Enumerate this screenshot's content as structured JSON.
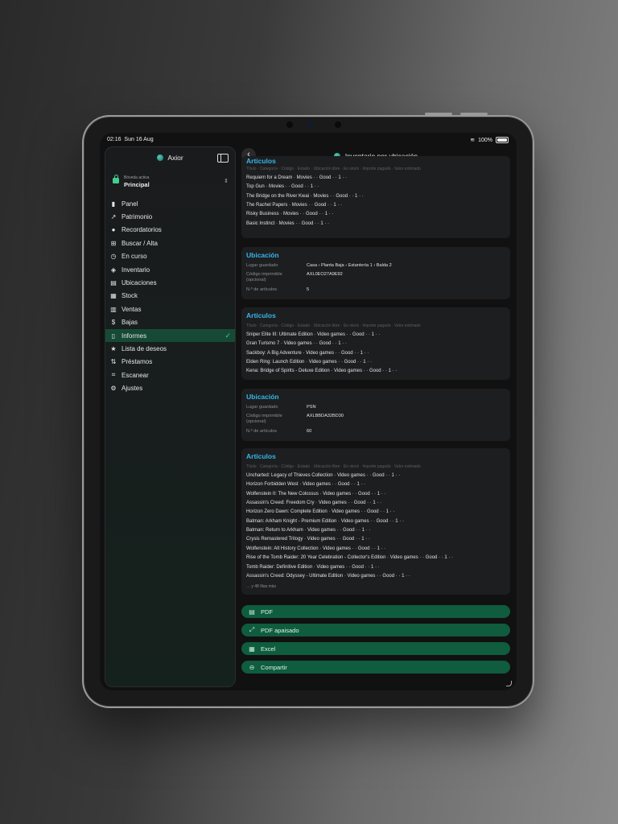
{
  "status": {
    "time": "02:16",
    "date": "Sun 16 Aug",
    "battery": "100%"
  },
  "sidebar": {
    "app_title": "Axior",
    "vault_label": "Bóveda activa",
    "vault_name": "Principal",
    "items": [
      {
        "label": "Panel",
        "icon": "bar-chart-icon",
        "glyph": "▮"
      },
      {
        "label": "Patrimonio",
        "icon": "trend-icon",
        "glyph": "↗"
      },
      {
        "label": "Recordatorios",
        "icon": "bell-icon",
        "glyph": "●"
      },
      {
        "label": "Buscar / Alta",
        "icon": "grid-icon",
        "glyph": "⊞"
      },
      {
        "label": "En curso",
        "icon": "clock-icon",
        "glyph": "◷"
      },
      {
        "label": "Inventario",
        "icon": "box-icon",
        "glyph": "◈"
      },
      {
        "label": "Ubicaciones",
        "icon": "map-icon",
        "glyph": "▤"
      },
      {
        "label": "Stock",
        "icon": "stack-icon",
        "glyph": "▦"
      },
      {
        "label": "Ventas",
        "icon": "barcode-icon",
        "glyph": "▥"
      },
      {
        "label": "Bajas",
        "icon": "dollar-icon",
        "glyph": "$"
      },
      {
        "label": "Informes",
        "icon": "document-icon",
        "glyph": "▯"
      },
      {
        "label": "Lista de deseos",
        "icon": "star-icon",
        "glyph": "★"
      },
      {
        "label": "Préstamos",
        "icon": "swap-icon",
        "glyph": "⇅"
      },
      {
        "label": "Escanear",
        "icon": "scan-icon",
        "glyph": "⌗"
      },
      {
        "label": "Ajustes",
        "icon": "gear-icon",
        "glyph": "⚙"
      }
    ],
    "active_index": 10
  },
  "main": {
    "title": "Inventario por ubicación",
    "columns_header": "Título · Categoría · Código · Estado · Ubicación libre · En stock · Importe pagado · Valor estimado",
    "cards": [
      {
        "type": "articles",
        "title": "Artículos",
        "header_partial": true,
        "rows": [
          "Requiem for a Dream · Movies · · Good · · 1 · ·",
          "Top Gun · Movies · · Good · · 1 · ·",
          "The Bridge on the River Kwai · Movies · · Good · · 1 · ·",
          "The Rachel Papers · Movies · · Good · · 1 · ·",
          "Risky Business · Movies · · Good · · 1 · ·",
          "Basic Instinct · Movies · · Good · · 1 · ·"
        ]
      },
      {
        "type": "location",
        "title": "Ubicación",
        "fields": [
          {
            "k": "Lugar guardado",
            "v": "Casa › Planta Baja › Estantería 1 › Balda 2"
          },
          {
            "k": "Código imprimible (opcional)",
            "v": "AXL0EO27A9E92"
          },
          {
            "k": "N.º de artículos",
            "v": "5"
          }
        ]
      },
      {
        "type": "articles",
        "title": "Artículos",
        "rows": [
          "Sniper Elite III: Ultimate Edition · Video games · · Good · · 1 · ·",
          "Gran Turismo 7 · Video games · · Good · · 1 · ·",
          "Sackboy: A Big Adventure · Video games · · Good · · 1 · ·",
          "Elden Ring: Launch Edition · Video games · · Good · · 1 · ·",
          "Kena: Bridge of Spirits - Deluxe Edition · Video games · · Good · · 1 · ·"
        ]
      },
      {
        "type": "location",
        "title": "Ubicación",
        "fields": [
          {
            "k": "Lugar guardado",
            "v": "PSN"
          },
          {
            "k": "Código imprimible (opcional)",
            "v": "AXLBBDA32BD30"
          },
          {
            "k": "N.º de artículos",
            "v": "60"
          }
        ]
      },
      {
        "type": "articles",
        "title": "Artículos",
        "rows": [
          "Uncharted: Legacy of Thieves Collection · Video games · · Good · · 1 · ·",
          "Horizon Forbidden West · Video games · · Good · · 1 · ·",
          "Wolfenstein II: The New Colossus · Video games · · Good · · 1 · ·",
          "Assassin's Creed: Freedom Cry · Video games · · Good · · 1 · ·",
          "Horizon Zero Dawn: Complete Edition · Video games · · Good · · 1 · ·",
          "Batman: Arkham Knight - Premium Edition · Video games · · Good · · 1 · ·",
          "Batman: Return to Arkham · Video games · · Good · · 1 · ·",
          "Crysis Remastered Trilogy · Video games · · Good · · 1 · ·",
          "Wolfenstein: Alt History Collection · Video games · · Good · · 1 · ·",
          "Rise of the Tomb Raider: 20 Year Celebration - Collector's Edition · Video games · · Good · · 1 · ·",
          "Tomb Raider: Definitive Edition · Video games · · Good · · 1 · ·",
          "Assassin's Creed: Odyssey - Ultimate Edition · Video games · · Good · · 1 · ·"
        ],
        "more": "… y 48 filas más"
      }
    ],
    "actions": [
      {
        "label": "PDF",
        "icon": "pdf-icon",
        "glyph": "▤"
      },
      {
        "label": "PDF apaisado",
        "icon": "pdf-landscape-icon",
        "glyph": "⤢"
      },
      {
        "label": "Excel",
        "icon": "table-icon",
        "glyph": "▦"
      },
      {
        "label": "Compartir",
        "icon": "share-icon",
        "glyph": "⊖"
      }
    ]
  }
}
